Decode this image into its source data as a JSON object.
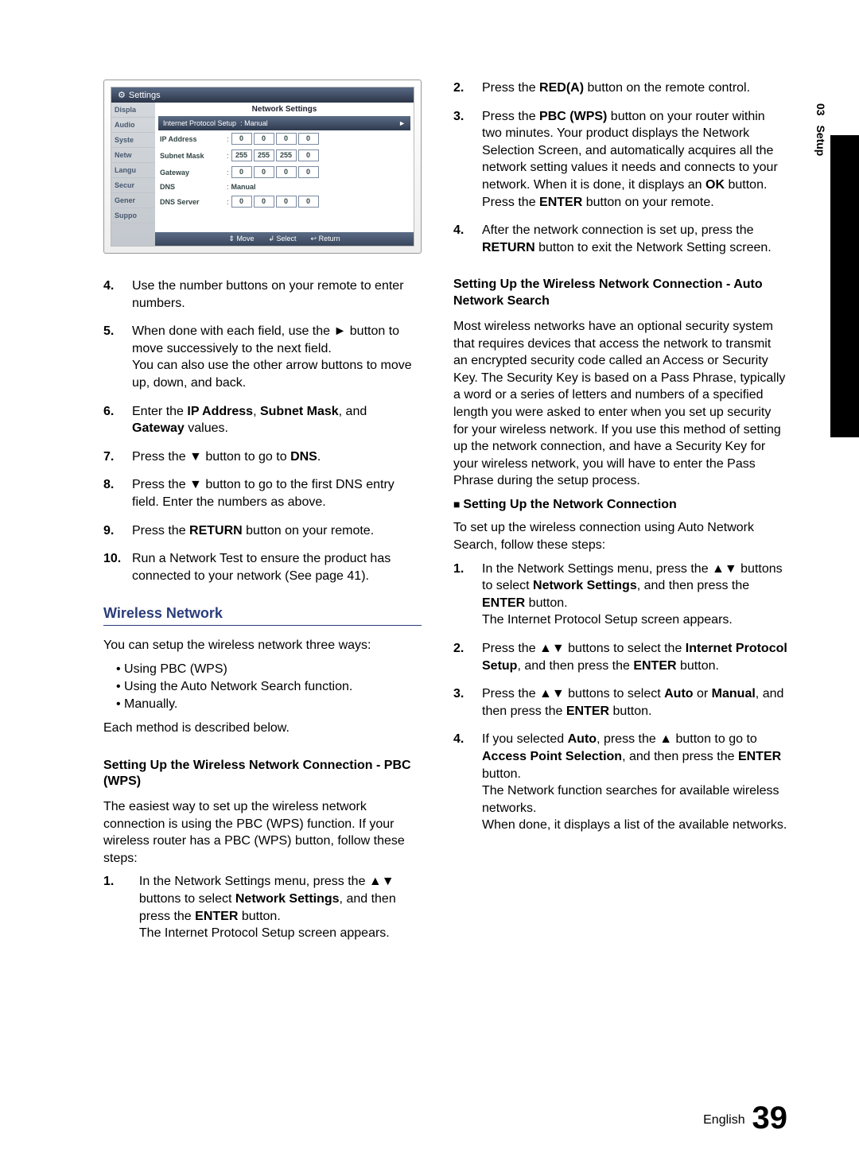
{
  "side_tab": {
    "nm": "03",
    "label": "Setup"
  },
  "screenshot": {
    "title": "Settings",
    "panel_title": "Network Settings",
    "dropdown_label": "Internet Protocol Setup",
    "dropdown_value": "Manual",
    "side_items": [
      "Displa",
      "Audio",
      "Syste",
      "Netw",
      "Langu",
      "Secur",
      "Gener",
      "Suppo"
    ],
    "rows": [
      {
        "label": "IP Address",
        "octets": [
          "0",
          "0",
          "0",
          "0"
        ]
      },
      {
        "label": "Subnet Mask",
        "octets": [
          "255",
          "255",
          "255",
          "0"
        ]
      },
      {
        "label": "Gateway",
        "octets": [
          "0",
          "0",
          "0",
          "0"
        ]
      }
    ],
    "dns_label": "DNS",
    "dns_value": "Manual",
    "dns_server": {
      "label": "DNS Server",
      "octets": [
        "0",
        "0",
        "0",
        "0"
      ]
    },
    "footer": {
      "move": "Move",
      "select": "Select",
      "return": "Return",
      "move_sym": "⇕",
      "select_sym": "↲",
      "return_sym": "↩"
    }
  },
  "left": {
    "steps_a": [
      {
        "n": "4.",
        "html": "Use the number buttons on your remote to enter numbers."
      },
      {
        "n": "5.",
        "html": "When done with each field, use the ► button to move successively to the next field.<br>You can also use the other arrow buttons to move up, down, and back."
      },
      {
        "n": "6.",
        "html": "Enter the <b>IP Address</b>, <b>Subnet Mask</b>, and <b>Gateway</b> values."
      },
      {
        "n": "7.",
        "html": "Press the ▼ button to go to <b>DNS</b>."
      },
      {
        "n": "8.",
        "html": "Press the ▼ button to go to the first DNS entry field. Enter the numbers as above."
      },
      {
        "n": "9.",
        "html": "Press the <b>RETURN</b> button on your remote."
      },
      {
        "n": "10.",
        "html": "Run a Network Test to ensure the product has connected to your network (See page 41)."
      }
    ],
    "wireless_head": "Wireless Network",
    "wireless_intro": "You can setup the wireless network three ways:",
    "wireless_bullets": [
      "Using PBC (WPS)",
      "Using the Auto Network Search function.",
      "Manually."
    ],
    "wireless_each": "Each method is described below.",
    "pbc_head": "Setting Up the Wireless Network Connection - PBC (WPS)",
    "pbc_intro": "The easiest way to set up the wireless network connection is using the PBC (WPS) function. If your wireless router has a PBC (WPS) button, follow these steps:",
    "pbc_step1": "In the Network Settings menu, press the ▲▼ buttons to select <b>Network Settings</b>, and then press the <b>ENTER</b> button.<br>The Internet Protocol Setup screen appears."
  },
  "right": {
    "pbc_steps": [
      {
        "n": "2.",
        "html": "Press the <b>RED(A)</b> button on the remote control."
      },
      {
        "n": "3.",
        "html": "Press the <b>PBC (WPS)</b> button on your router within two minutes. Your product displays the Network Selection Screen, and automatically acquires all the network setting values it needs and connects to your network. When it is done, it displays an <b>OK</b> button. Press the <b>ENTER</b> button on your remote."
      },
      {
        "n": "4.",
        "html": "After the network connection is set up, press the <b>RETURN</b> button to exit the Network Setting screen."
      }
    ],
    "auto_head": "Setting Up the Wireless Network Connection - Auto Network Search",
    "auto_body": "Most wireless networks have an optional security system that requires devices that access the network to transmit an encrypted security code called an Access or Security Key. The Security Key is based on a Pass Phrase, typically a word or a series of letters and numbers of a specified length you were asked to enter when you set up security for your wireless network. If you use this method of setting up the network connection, and have a Security Key for your wireless network, you will have to enter the Pass Phrase during the setup process.",
    "auto_bullet_head": "Setting Up the Network Connection",
    "auto_intro": "To set up the wireless connection using Auto Network Search, follow these steps:",
    "auto_steps": [
      {
        "n": "1.",
        "html": "In the Network Settings menu, press the ▲▼ buttons to select <b>Network Settings</b>, and then press the <b>ENTER</b> button.<br>The Internet Protocol Setup screen appears."
      },
      {
        "n": "2.",
        "html": "Press the ▲▼ buttons to select the <b>Internet Protocol Setup</b>, and then press the <b>ENTER</b> button."
      },
      {
        "n": "3.",
        "html": "Press the ▲▼ buttons to select <b>Auto</b> or <b>Manual</b>, and then press the <b>ENTER</b> button."
      },
      {
        "n": "4.",
        "html": "If you selected <b>Auto</b>, press the ▲ button to go to <b>Access Point Selection</b>, and then press the <b>ENTER</b> button.<br>The Network function searches for available wireless networks.<br>When done, it displays a list of the available networks."
      }
    ]
  },
  "footer": {
    "lang": "English",
    "page": "39"
  }
}
